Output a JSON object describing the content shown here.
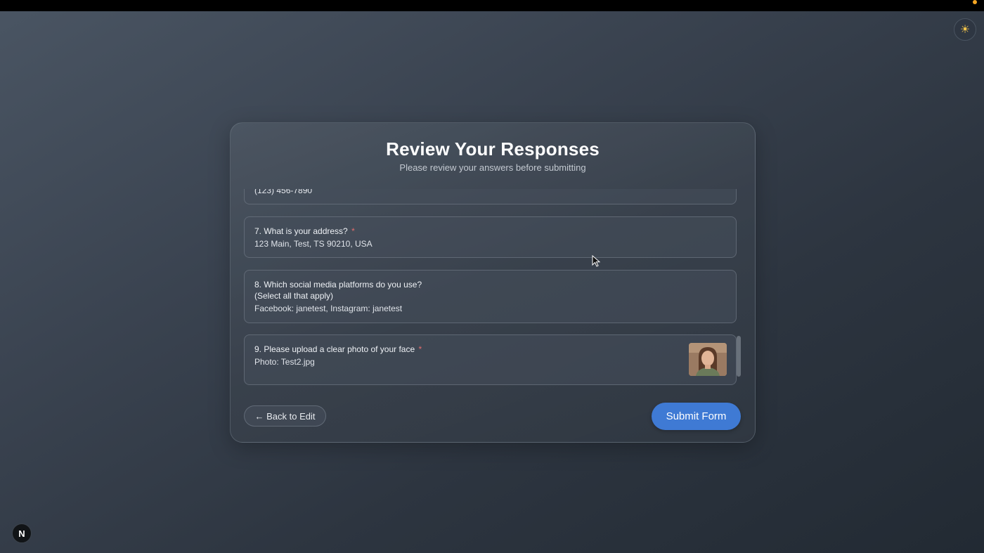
{
  "header": {
    "title": "Review Your Responses",
    "subtitle": "Please review your answers before submitting"
  },
  "answers": {
    "partial_value": "(123) 456-7890",
    "q7": {
      "label": "7. What is your address?",
      "required_mark": "*",
      "value": "123 Main, Test, TS 90210, USA"
    },
    "q8": {
      "label_line1": "8. Which social media platforms do you use?",
      "label_line2": "(Select all that apply)",
      "value": "Facebook: janetest, Instagram: janetest"
    },
    "q9": {
      "label": "9. Please upload a clear photo of your face",
      "required_mark": "*",
      "value": "Photo: Test2.jpg"
    }
  },
  "actions": {
    "back_label": "← Back to Edit",
    "submit_label": "Submit Form"
  },
  "icons": {
    "theme_toggle": "sun-icon",
    "theme_toggle_glyph": "☀",
    "corner_badge": "N"
  },
  "colors": {
    "accent": "#3f7ad4",
    "required": "#e26d6d",
    "notification_dot": "#f5a623"
  }
}
